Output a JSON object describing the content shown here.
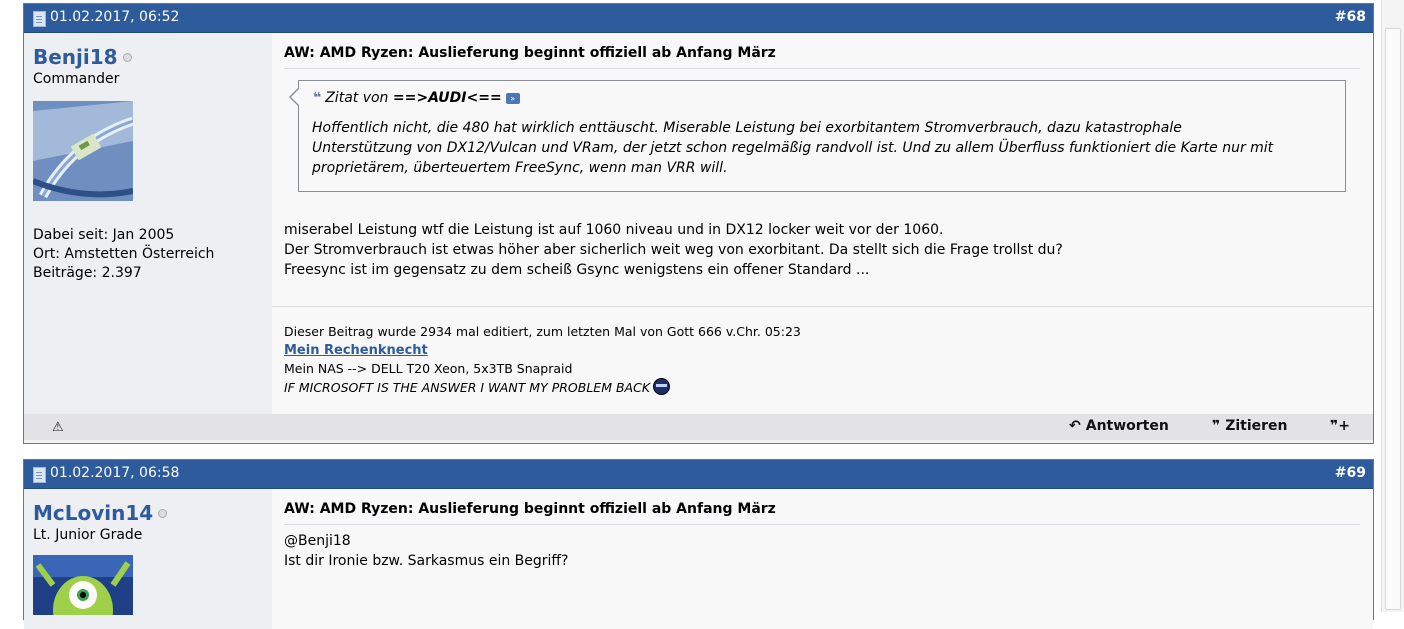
{
  "posts": [
    {
      "date": "01.02.2017, 06:52",
      "number": "#68",
      "username": "Benji18",
      "usertitle": "Commander",
      "stats": [
        "Dabei seit: Jan 2005",
        "Ort: Amstetten Österreich",
        "Beiträge: 2.397"
      ],
      "title": "AW: AMD Ryzen: Auslieferung beginnt offiziell ab Anfang März",
      "quote": {
        "prefix": "Zitat von ",
        "author": "==>AUDI<==",
        "lines": [
          "Hoffentlich nicht, die 480 hat wirklich enttäuscht. Miserable Leistung bei exorbitantem Stromverbrauch, dazu katastrophale",
          "Unterstützung von DX12/Vulcan und VRam, der jetzt schon regelmäßig randvoll ist. Und zu allem Überfluss funktioniert die Karte nur mit",
          "proprietärem, überteuertem FreeSync, wenn man VRR will."
        ]
      },
      "message": [
        "miserabel Leistung wtf die Leistung ist auf 1060 niveau und in DX12 locker weit vor der 1060.",
        "Der Stromverbrauch ist etwas höher aber sicherlich weit weg von exorbitant. Da stellt sich die Frage trollst du?",
        "Freesync ist im gegensatz zu dem scheiß Gsync wenigstens ein offener Standard ..."
      ],
      "signature": {
        "edited": "Dieser Beitrag wurde 2934 mal editiert, zum letzten Mal von Gott 666 v.Chr. 05:23",
        "link": "Mein Rechenknecht",
        "nas": "Mein NAS --> DELL T20 Xeon, 5x3TB Snapraid",
        "motto": "IF MICROSOFT IS THE ANSWER I WANT MY PROBLEM BACK"
      },
      "actions": {
        "reply": "Antworten",
        "quote": "Zitieren"
      }
    },
    {
      "date": "01.02.2017, 06:58",
      "number": "#69",
      "username": "McLovin14",
      "usertitle": "Lt. Junior Grade",
      "title": "AW: AMD Ryzen: Auslieferung beginnt offiziell ab Anfang März",
      "message": [
        "@Benji18",
        "Ist dir Ironie bzw. Sarkasmus ein Begriff?"
      ]
    }
  ],
  "icons": {
    "warning": "⚠",
    "reply": "↶",
    "quote": "❞",
    "multiquote": "❞+",
    "quote_marks": "❝",
    "quote_link": "»"
  },
  "colors": {
    "header": "#2d5b9b",
    "username": "#2d5b9b",
    "footer": "#e3e3e6"
  }
}
